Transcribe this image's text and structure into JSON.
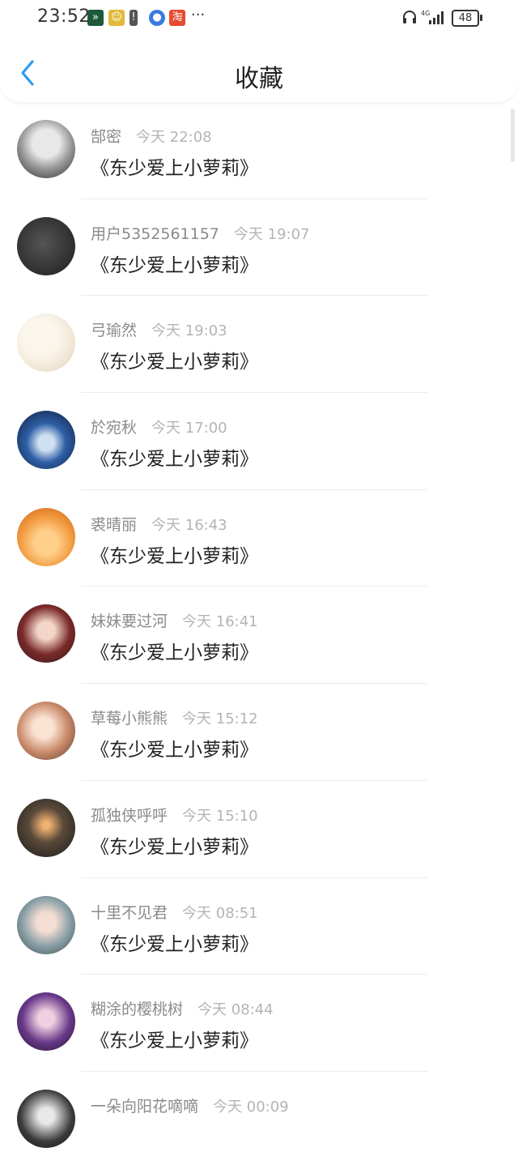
{
  "status": {
    "time": "23:52",
    "network": "4G",
    "battery": "48"
  },
  "header": {
    "title": "收藏",
    "back_icon": "chevron-left-icon",
    "accent": "#2b9cf2"
  },
  "items": [
    {
      "name": "郜密",
      "time": "今天 22:08",
      "content": "《东少爱上小萝莉》"
    },
    {
      "name": "用户5352561157",
      "time": "今天 19:07",
      "content": "《东少爱上小萝莉》"
    },
    {
      "name": "弓瑜然",
      "time": "今天 19:03",
      "content": "《东少爱上小萝莉》"
    },
    {
      "name": "於宛秋",
      "time": "今天 17:00",
      "content": "《东少爱上小萝莉》"
    },
    {
      "name": "裘晴丽",
      "time": "今天 16:43",
      "content": "《东少爱上小萝莉》"
    },
    {
      "name": "妹妹要过河",
      "time": "今天 16:41",
      "content": "《东少爱上小萝莉》"
    },
    {
      "name": "草莓小熊熊",
      "time": "今天 15:12",
      "content": "《东少爱上小萝莉》"
    },
    {
      "name": "孤独侠呼呼",
      "time": "今天 15:10",
      "content": "《东少爱上小萝莉》"
    },
    {
      "name": "十里不见君",
      "time": "今天 08:51",
      "content": "《东少爱上小萝莉》"
    },
    {
      "name": "糊涂的樱桃树",
      "time": "今天 08:44",
      "content": "《东少爱上小萝莉》"
    },
    {
      "name": "一朵向阳花嘀嘀",
      "time": "今天 00:09",
      "content": ""
    }
  ]
}
